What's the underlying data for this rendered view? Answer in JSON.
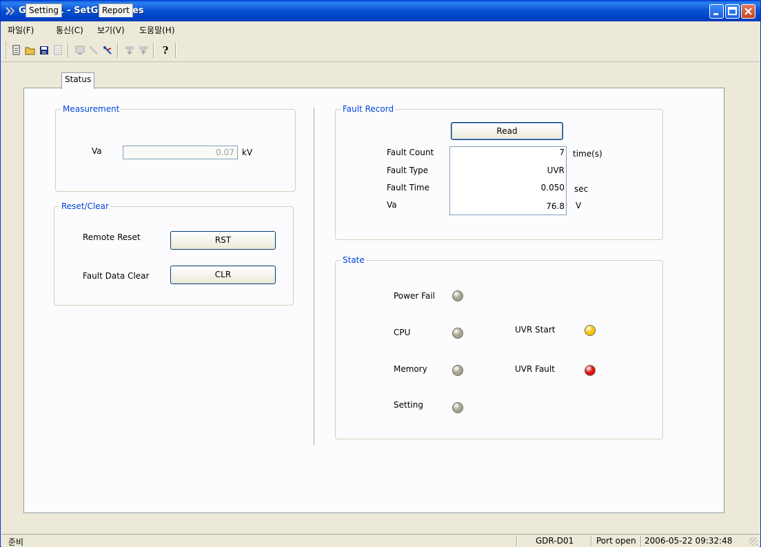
{
  "window": {
    "title": "GDR-D01 - SetGDRSeries",
    "buttons": {
      "minimize": "_",
      "maximize": "□",
      "close": "✕"
    }
  },
  "menu": [
    "파일(F)",
    "통신(C)",
    "보기(V)",
    "도움말(H)"
  ],
  "tabs": [
    "Setting",
    "Status",
    "Report"
  ],
  "active_tab": "Status",
  "measurement": {
    "title": "Measurement",
    "va_label": "Va",
    "va_value": "0.07",
    "va_unit": "kV"
  },
  "reset_clear": {
    "title": "Reset/Clear",
    "remote_reset_label": "Remote Reset",
    "rst_button": "RST",
    "fault_data_clear_label": "Fault Data Clear",
    "clr_button": "CLR"
  },
  "fault_record": {
    "title": "Fault Record",
    "read_button": "Read",
    "rows": [
      {
        "label": "Fault Count",
        "value": "7",
        "unit": "time(s)"
      },
      {
        "label": "Fault Type",
        "value": "UVR",
        "unit": ""
      },
      {
        "label": "Fault Time",
        "value": "0.050",
        "unit": "sec"
      },
      {
        "label": "Va",
        "value": "76.8",
        "unit": "V"
      }
    ]
  },
  "state": {
    "title": "State",
    "indicators": [
      {
        "label": "Power Fail",
        "status": "off",
        "color": "#a8a590"
      },
      {
        "label": "CPU",
        "status": "off",
        "color": "#a8a590"
      },
      {
        "label": "Memory",
        "status": "off",
        "color": "#a8a590"
      },
      {
        "label": "Setting",
        "status": "off",
        "color": "#a8a590"
      },
      {
        "label": "UVR Start",
        "status": "on",
        "color": "#f5c400"
      },
      {
        "label": "UVR Fault",
        "status": "on",
        "color": "#e01010"
      }
    ]
  },
  "statusbar": {
    "left": "준비",
    "device": "GDR-D01",
    "port": "Port open",
    "datetime": "2006-05-22 09:32:48"
  },
  "colors": {
    "group_title": "#0046d5",
    "title_bar": "#0a55d3"
  }
}
